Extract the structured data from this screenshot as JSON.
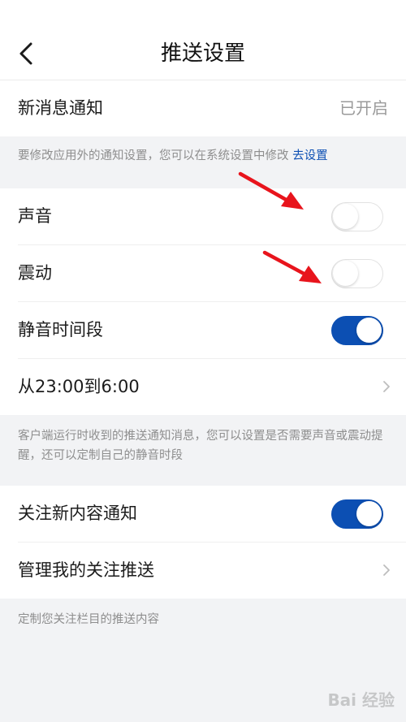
{
  "header": {
    "title": "推送设置",
    "back_icon": "chevron-left-icon"
  },
  "new_message": {
    "label": "新消息通知",
    "value": "已开启"
  },
  "system_note": {
    "text": "要修改应用外的通知设置，您可以在系统设置中修改",
    "link": "去设置"
  },
  "sound_group": {
    "sound": {
      "label": "声音",
      "on": false
    },
    "vibrate": {
      "label": "震动",
      "on": false
    },
    "quiet_hours": {
      "label": "静音时间段",
      "on": true
    },
    "quiet_range": {
      "label": "从23:00到6:00"
    }
  },
  "quiet_note": {
    "text": "客户端运行时收到的推送通知消息，您可以设置是否需要声音或震动提醒，还可以定制自己的静音时段"
  },
  "follow_group": {
    "follow_new": {
      "label": "关注新内容通知",
      "on": true
    },
    "manage_follow": {
      "label": "管理我的关注推送"
    }
  },
  "follow_note": {
    "text": "定制您关注栏目的推送内容"
  },
  "watermark": "Bai 经验",
  "colors": {
    "accent": "#0c4fb3",
    "background": "#f2f3f5",
    "annotation_arrow": "#e8141c"
  }
}
